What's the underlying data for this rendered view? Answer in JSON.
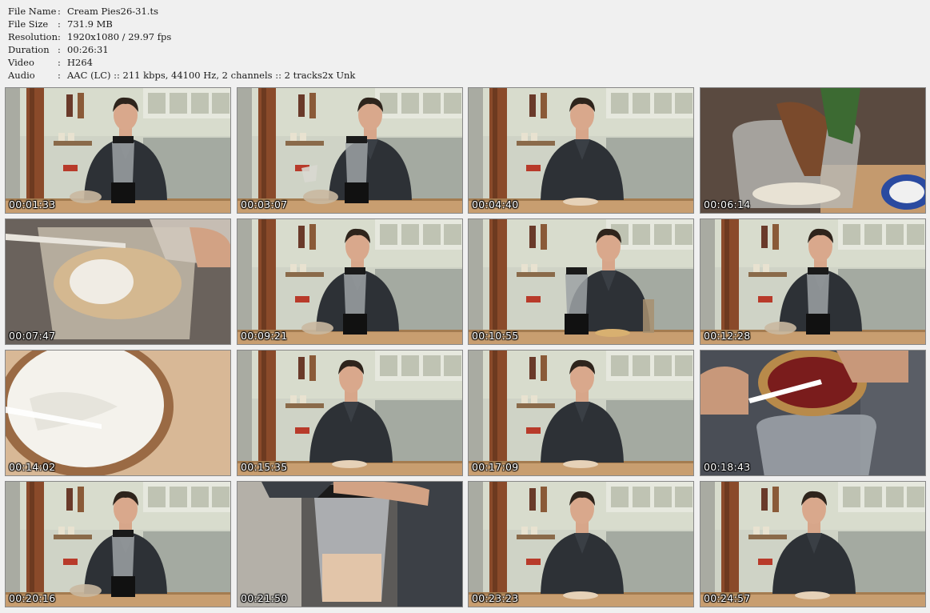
{
  "info": {
    "rows": [
      {
        "key": "File Name",
        "sep": ":",
        "value": "Cream Pies26-31.ts"
      },
      {
        "key": "File Size",
        "sep": ":",
        "value": "731.9 MB"
      },
      {
        "key": "Resolution",
        "sep": ":",
        "value": "1920x1080 / 29.97 fps"
      },
      {
        "key": "Duration",
        "sep": ":",
        "value": "00:26:31"
      },
      {
        "key": "Video",
        "sep": ":",
        "value": "H264"
      },
      {
        "key": "Audio",
        "sep": ":",
        "value": "AAC (LC) :: 211 kbps, 44100 Hz, 2 channels :: 2 tracks2x Unk"
      }
    ]
  },
  "thumbnails": [
    {
      "timestamp": "00:01:33",
      "scene": "kitchen-host-blender"
    },
    {
      "timestamp": "00:03:07",
      "scene": "kitchen-host-pouring"
    },
    {
      "timestamp": "00:04:40",
      "scene": "kitchen-host-talking"
    },
    {
      "timestamp": "00:06:14",
      "scene": "closeup-pour-chocolate"
    },
    {
      "timestamp": "00:07:47",
      "scene": "closeup-blender-powder"
    },
    {
      "timestamp": "00:09:21",
      "scene": "kitchen-host-blender"
    },
    {
      "timestamp": "00:10:55",
      "scene": "kitchen-host-spatula"
    },
    {
      "timestamp": "00:12:28",
      "scene": "kitchen-host-blender"
    },
    {
      "timestamp": "00:14:02",
      "scene": "closeup-cream-pie"
    },
    {
      "timestamp": "00:15:35",
      "scene": "kitchen-host-talking"
    },
    {
      "timestamp": "00:17:09",
      "scene": "kitchen-host-talking"
    },
    {
      "timestamp": "00:18:43",
      "scene": "closeup-pour-red"
    },
    {
      "timestamp": "00:20:16",
      "scene": "kitchen-host-blender"
    },
    {
      "timestamp": "00:21:50",
      "scene": "closeup-blender-hands"
    },
    {
      "timestamp": "00:23:23",
      "scene": "kitchen-host-talking"
    },
    {
      "timestamp": "00:24:57",
      "scene": "kitchen-host-talking"
    }
  ]
}
